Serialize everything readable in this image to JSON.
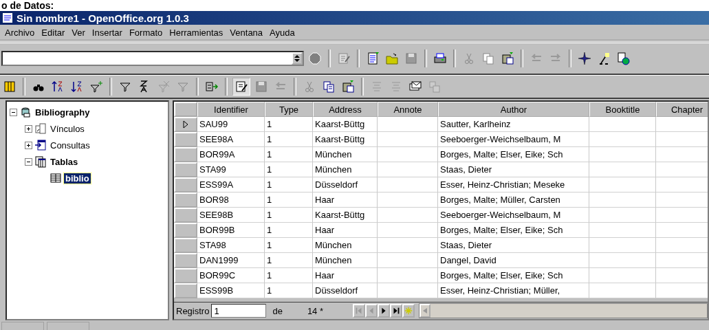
{
  "page_caption": "o de Datos:",
  "window": {
    "title": "Sin nombre1 - OpenOffice.org 1.0.3"
  },
  "menu": [
    "Archivo",
    "Editar",
    "Ver",
    "Insertar",
    "Formato",
    "Herramientas",
    "Ventana",
    "Ayuda"
  ],
  "tree": [
    {
      "label": "Bibliography",
      "kind": "database",
      "expanded": true,
      "selected": false,
      "children": [
        {
          "label": "Vínculos",
          "kind": "links",
          "expanded": false,
          "selected": false
        },
        {
          "label": "Consultas",
          "kind": "queries",
          "expanded": false,
          "selected": false
        },
        {
          "label": "Tablas",
          "kind": "tables",
          "expanded": true,
          "selected": false,
          "children": [
            {
              "label": "biblio",
              "kind": "table",
              "selected": true
            }
          ]
        }
      ]
    }
  ],
  "table": {
    "columns": [
      "Identifier",
      "Type",
      "Address",
      "Annote",
      "Author",
      "Booktitle",
      "Chapter"
    ],
    "rows": [
      {
        "current": true,
        "cells": [
          "SAU99",
          "1",
          "Kaarst-Büttg",
          "",
          "Sautter, Karlheinz",
          "",
          ""
        ]
      },
      {
        "current": false,
        "cells": [
          "SEE98A",
          "1",
          "Kaarst-Büttg",
          "",
          "Seeboerger-Weichselbaum, M",
          "",
          ""
        ]
      },
      {
        "current": false,
        "cells": [
          "BOR99A",
          "1",
          "München",
          "",
          "Borges, Malte; Elser, Eike; Sch",
          "",
          ""
        ]
      },
      {
        "current": false,
        "cells": [
          "STA99",
          "1",
          "München",
          "",
          "Staas, Dieter",
          "",
          ""
        ]
      },
      {
        "current": false,
        "cells": [
          "ESS99A",
          "1",
          "Düsseldorf",
          "",
          "Esser, Heinz-Christian; Meseke",
          "",
          ""
        ]
      },
      {
        "current": false,
        "cells": [
          "BOR98",
          "1",
          "Haar",
          "",
          "Borges, Malte; Müller, Carsten",
          "",
          ""
        ]
      },
      {
        "current": false,
        "cells": [
          "SEE98B",
          "1",
          "Kaarst-Büttg",
          "",
          "Seeboerger-Weichselbaum, M",
          "",
          ""
        ]
      },
      {
        "current": false,
        "cells": [
          "BOR99B",
          "1",
          "Haar",
          "",
          "Borges, Malte; Elser, Eike; Sch",
          "",
          ""
        ]
      },
      {
        "current": false,
        "cells": [
          "STA98",
          "1",
          "München",
          "",
          "Staas, Dieter",
          "",
          ""
        ]
      },
      {
        "current": false,
        "cells": [
          "DAN1999",
          "1",
          "München",
          "",
          "Dangel, David",
          "",
          ""
        ]
      },
      {
        "current": false,
        "cells": [
          "BOR99C",
          "1",
          "Haar",
          "",
          "Borges, Malte; Elser, Eike; Sch",
          "",
          ""
        ]
      },
      {
        "current": false,
        "cells": [
          "ESS99B",
          "1",
          "Düsseldorf",
          "",
          "Esser, Heinz-Christian; Müller,",
          "",
          ""
        ]
      }
    ]
  },
  "record_bar": {
    "label": "Registro",
    "value": "1",
    "of_label": "de",
    "count": "14 *",
    "nav_buttons": [
      {
        "kind": "first",
        "disabled": true
      },
      {
        "kind": "previous",
        "disabled": true
      },
      {
        "kind": "next",
        "disabled": false
      },
      {
        "kind": "last",
        "disabled": false
      },
      {
        "kind": "new",
        "disabled": false
      }
    ]
  }
}
